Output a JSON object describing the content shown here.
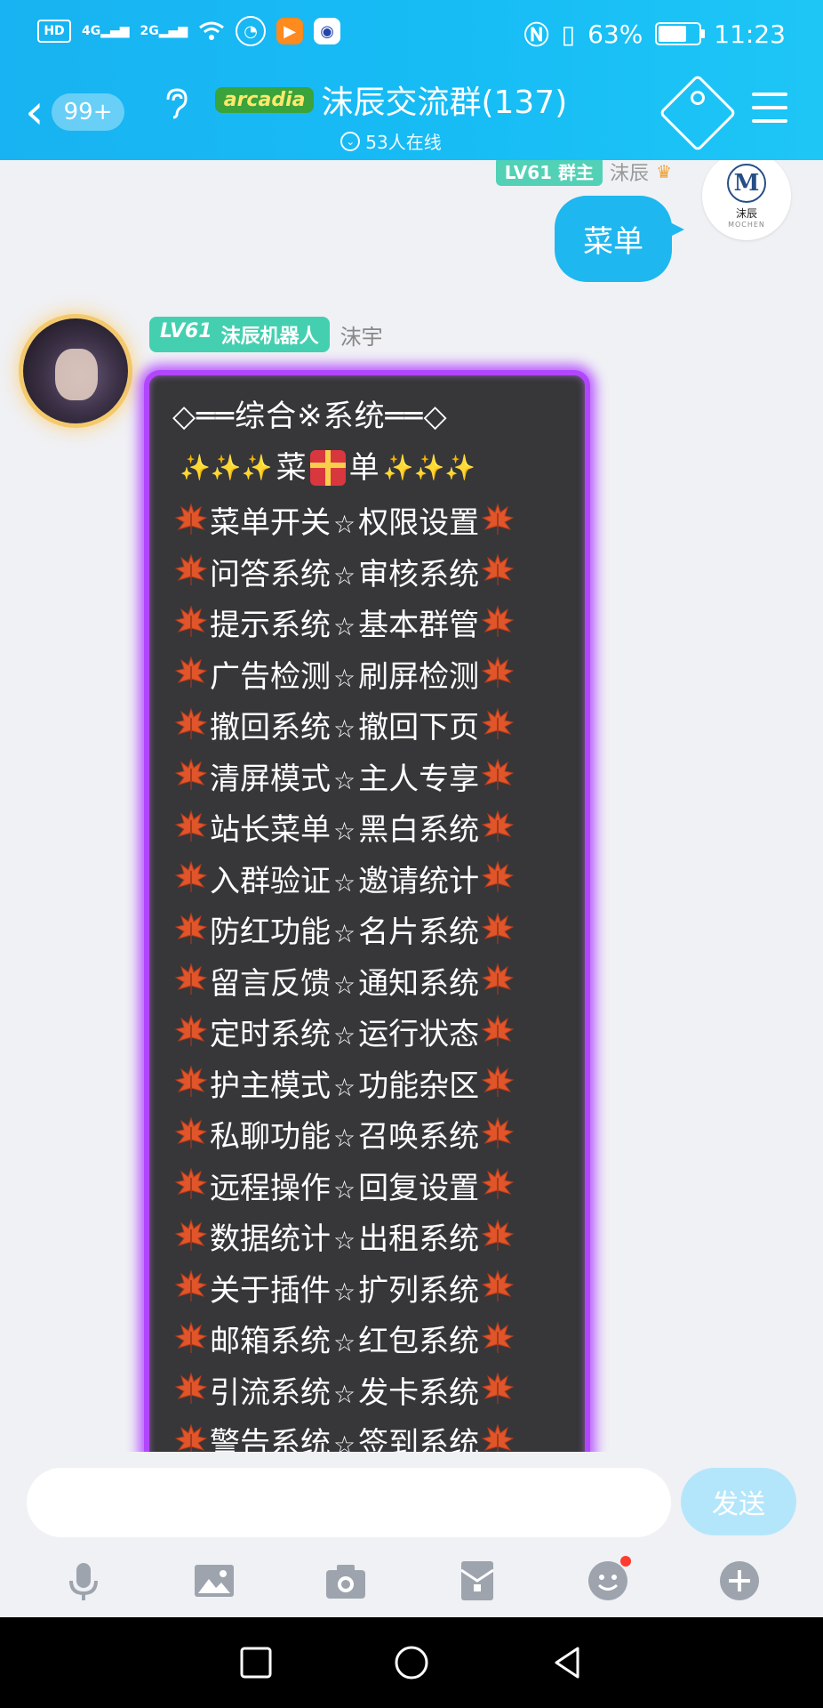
{
  "status_bar": {
    "hd": "HD",
    "net1": "4G",
    "net2": "2G",
    "battery": "63%",
    "time": "11:23"
  },
  "header": {
    "back_badge": "99+",
    "tag": "arcadia",
    "title": "沫辰交流群(137)",
    "subtitle": "53人在线"
  },
  "my_message": {
    "level": "LV61 群主",
    "name": "沫辰",
    "text": "菜单",
    "avatar": {
      "letter": "M",
      "cn": "沫辰",
      "en": "MOCHEN"
    }
  },
  "bot_message": {
    "level": "LV61",
    "role": "沫辰机器人",
    "name": "沫宇",
    "header_line": "◇══综合※系统══◇",
    "title_left": "菜",
    "title_right": "单",
    "rows": [
      {
        "left": "菜单开关",
        "right": "权限设置"
      },
      {
        "left": "问答系统",
        "right": "审核系统"
      },
      {
        "left": "提示系统",
        "right": "基本群管"
      },
      {
        "left": "广告检测",
        "right": "刷屏检测"
      },
      {
        "left": "撤回系统",
        "right": "撤回下页"
      },
      {
        "left": "清屏模式",
        "right": "主人专享"
      },
      {
        "left": "站长菜单",
        "right": "黑白系统"
      },
      {
        "left": "入群验证",
        "right": "邀请统计"
      },
      {
        "left": "防红功能",
        "right": "名片系统"
      },
      {
        "left": "留言反馈",
        "right": "通知系统"
      },
      {
        "left": "定时系统",
        "right": "运行状态"
      },
      {
        "left": "护主模式",
        "right": "功能杂区"
      },
      {
        "left": "私聊功能",
        "right": "召唤系统"
      },
      {
        "left": "远程操作",
        "right": "回复设置"
      },
      {
        "left": "数据统计",
        "right": "出租系统"
      },
      {
        "left": "关于插件",
        "right": "扩列系统"
      },
      {
        "left": "邮箱系统",
        "right": "红包系统"
      },
      {
        "left": "引流系统",
        "right": "发卡系统"
      },
      {
        "left": "警告系统",
        "right": "签到系统"
      }
    ]
  },
  "input": {
    "placeholder": "",
    "send_label": "发送"
  },
  "toolbar_icons": [
    "microphone-icon",
    "image-icon",
    "camera-icon",
    "red-packet-icon",
    "emoji-icon",
    "plus-icon"
  ],
  "colors": {
    "accent": "#1fb7f0",
    "glow": "#b246ff",
    "bubble_dark": "#373739"
  }
}
